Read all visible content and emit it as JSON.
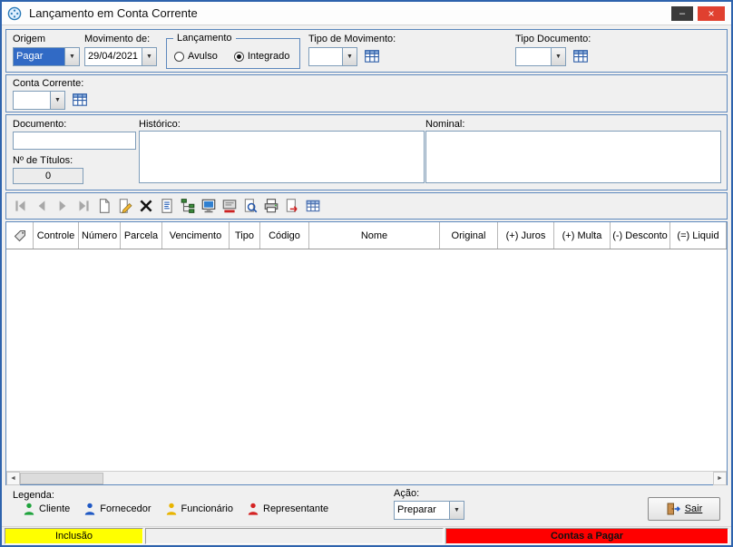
{
  "window": {
    "title": "Lançamento em Conta Corrente",
    "minimize_glyph": "–",
    "close_glyph": "×"
  },
  "glyphs": {
    "combo_arrow": "▼",
    "scroll_left": "◄",
    "scroll_right": "►"
  },
  "filters": {
    "origem_label": "Origem",
    "origem_value": "Pagar",
    "movimento_label": "Movimento de:",
    "movimento_value": "29/04/2021",
    "lancamento_group": "Lançamento",
    "avulso": "Avulso",
    "integrado": "Integrado",
    "tipo_movimento_label": "Tipo de Movimento:",
    "tipo_documento_label": "Tipo Documento:"
  },
  "conta_corrente": {
    "label": "Conta Corrente:"
  },
  "documento": {
    "documento_label": "Documento:",
    "titulos_label": "Nº de Títulos:",
    "titulos_value": "0",
    "historico_label": "Histórico:",
    "nominal_label": "Nominal:"
  },
  "toolbar": {
    "icons": [
      "first-record",
      "previous-record",
      "next-record",
      "last-record",
      "new-document",
      "edit-document",
      "delete",
      "document-details",
      "tree-view",
      "monitor",
      "editor",
      "print-preview",
      "print",
      "export",
      "grid"
    ]
  },
  "table": {
    "columns": [
      "Controle",
      "Número",
      "Parcela",
      "Vencimento",
      "Tipo",
      "Código",
      "Nome",
      "Original",
      "(+) Juros",
      "(+) Multa",
      "(-) Desconto",
      "(=) Liquid"
    ]
  },
  "legend": {
    "label": "Legenda:",
    "items": [
      {
        "label": "Cliente",
        "color": "#1fa33c"
      },
      {
        "label": "Fornecedor",
        "color": "#1f58c4"
      },
      {
        "label": "Funcionário",
        "color": "#e8b400"
      },
      {
        "label": "Representante",
        "color": "#d42323"
      }
    ]
  },
  "acao": {
    "label": "Ação:",
    "value": "Preparar"
  },
  "buttons": {
    "sair": "Sair"
  },
  "statusbar": {
    "mode": "Inclusão",
    "context": "Contas a Pagar",
    "mode_bg": "#ffff00",
    "context_bg": "#ff0000"
  },
  "colors": {
    "selection_bg": "#316ac5",
    "selection_fg": "#ffffff",
    "panel_border": "#5d88bd"
  }
}
